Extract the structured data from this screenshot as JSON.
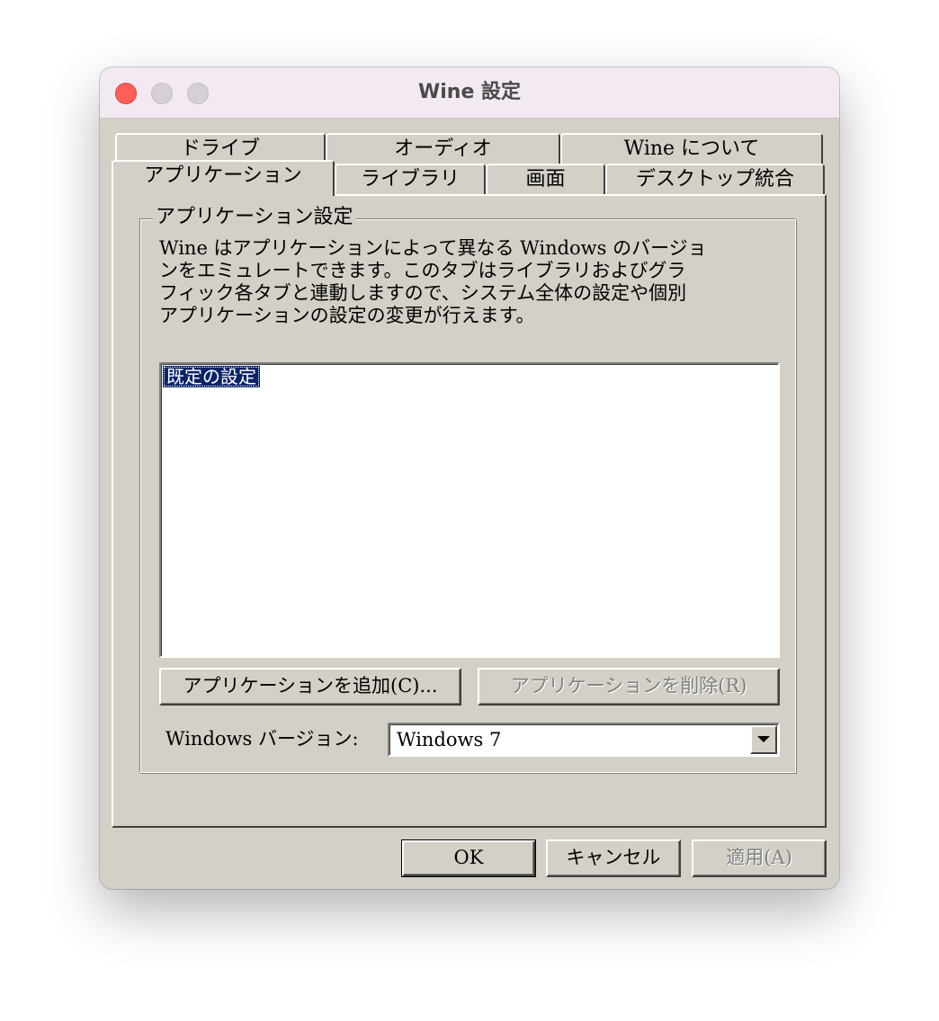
{
  "window": {
    "title": "Wine 設定"
  },
  "tabs_back_row": [
    {
      "label": "ドライブ"
    },
    {
      "label": "オーディオ"
    },
    {
      "label": "Wine について"
    }
  ],
  "tabs_front_row": [
    {
      "label": "アプリケーション",
      "selected": true
    },
    {
      "label": "ライブラリ",
      "selected": false
    },
    {
      "label": "画面",
      "selected": false
    },
    {
      "label": "デスクトップ統合",
      "selected": false
    }
  ],
  "app_settings": {
    "group_title": "アプリケーション設定",
    "description_lines": [
      "Wine はアプリケーションによって異なる Windows のバージョ",
      "ンをエミュレートできます。このタブはライブラリおよびグラ",
      "フィック各タブと連動しますので、システム全体の設定や個別",
      "アプリケーションの設定の変更が行えます。"
    ],
    "list_items": [
      {
        "label": "既定の設定",
        "selected": true
      }
    ],
    "add_button": "アプリケーションを追加(C)...",
    "remove_button": "アプリケーションを削除(R)",
    "windows_version_label": "Windows バージョン:",
    "windows_version_value": "Windows 7"
  },
  "footer": {
    "ok": "OK",
    "cancel": "キャンセル",
    "apply": "適用(A)"
  },
  "colors": {
    "dialog_bg": "#d4d0c8",
    "titlebar_bg": "#f2e9f3",
    "selection_bg": "#0a246a",
    "close_button": "#fe5f57"
  }
}
